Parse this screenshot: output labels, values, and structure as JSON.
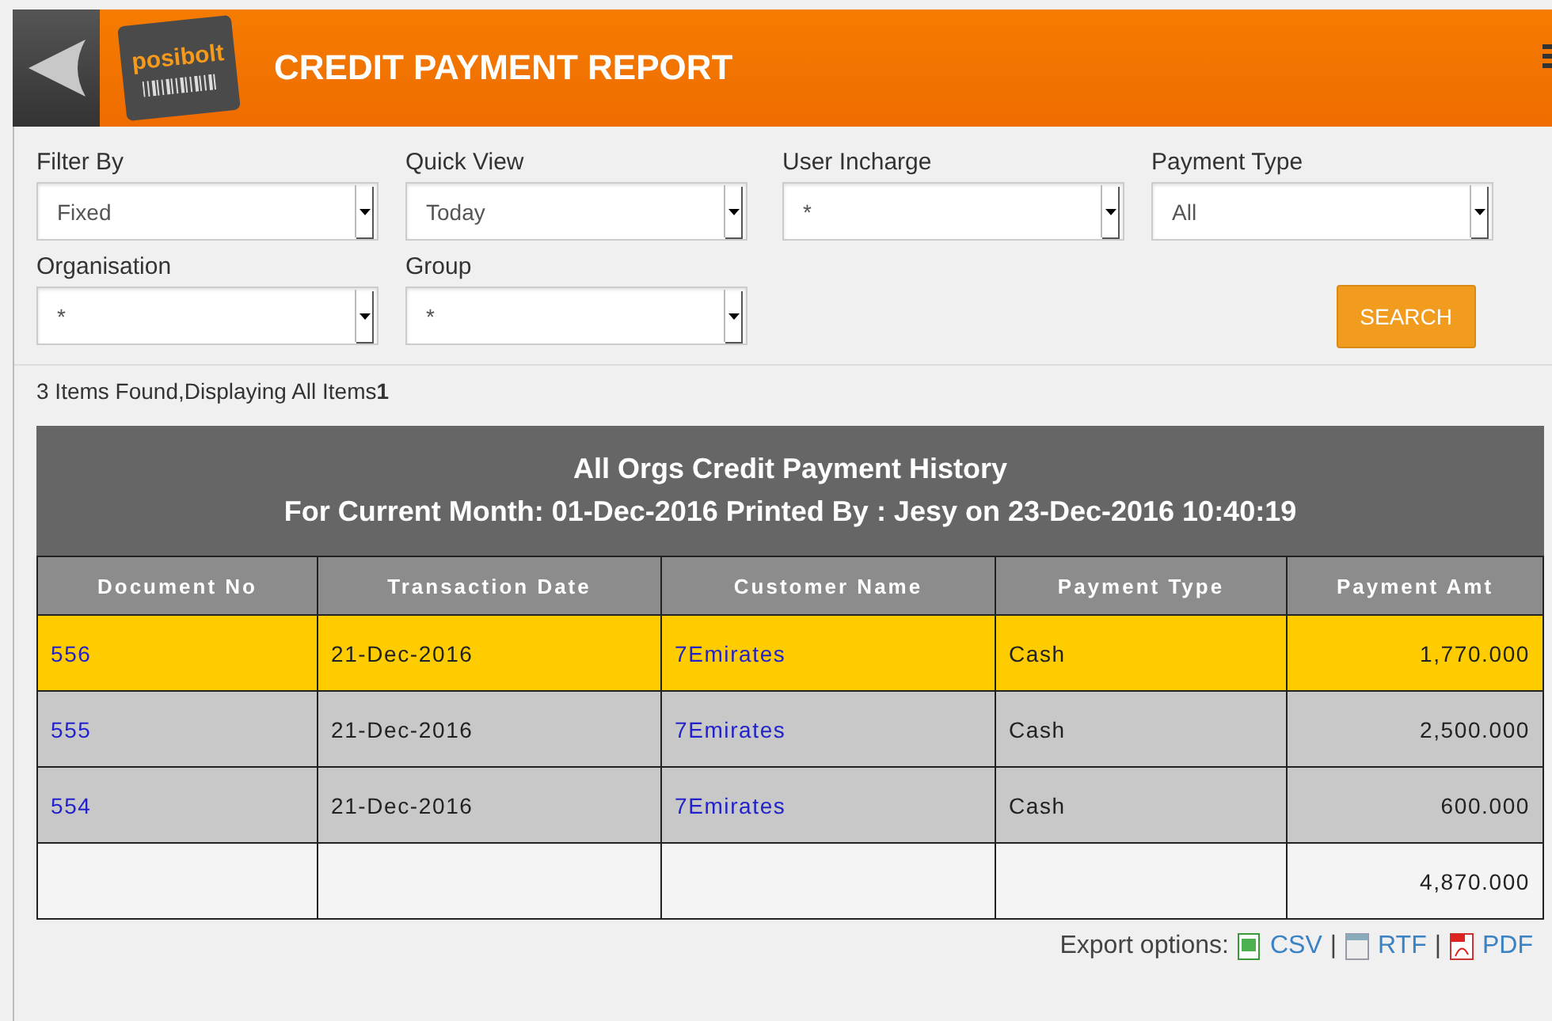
{
  "header": {
    "logo": "posibolt",
    "title": "CREDIT PAYMENT REPORT"
  },
  "filters": [
    {
      "label": "Filter By",
      "value": "Fixed"
    },
    {
      "label": "Quick View",
      "value": "Today"
    },
    {
      "label": "User Incharge",
      "value": "*"
    },
    {
      "label": "Payment Type",
      "value": "All"
    },
    {
      "label": "Organisation",
      "value": "*"
    },
    {
      "label": "Group",
      "value": "*"
    }
  ],
  "search_button": "SEARCH",
  "result_summary": "3 Items Found,Displaying All Items**1**",
  "report": {
    "title": "All Orgs Credit Payment History",
    "subtitle": "For Current Month: 01-Dec-2016 Printed By : Jesy on 23-Dec-2016 10:40:19",
    "columns": [
      "Document No",
      "Transaction Date",
      "Customer Name",
      "Payment Type",
      "Payment Amt"
    ],
    "rows": [
      {
        "document_no": "556",
        "date": "21-Dec-2016",
        "customer": "7Emirates",
        "payment_type": "Cash",
        "amount": "1,770.000",
        "selected": true
      },
      {
        "document_no": "555",
        "date": "21-Dec-2016",
        "customer": "7Emirates",
        "payment_type": "Cash",
        "amount": "2,500.000",
        "selected": false
      },
      {
        "document_no": "554",
        "date": "21-Dec-2016",
        "customer": "7Emirates",
        "payment_type": "Cash",
        "amount": "600.000",
        "selected": false
      }
    ],
    "total": "4,870.000"
  },
  "export": {
    "label": "Export options:",
    "separator": "|",
    "options": [
      {
        "kind": "csv",
        "label": "CSV"
      },
      {
        "kind": "rtf",
        "label": "RTF"
      },
      {
        "kind": "pdf",
        "label": "PDF"
      }
    ]
  }
}
